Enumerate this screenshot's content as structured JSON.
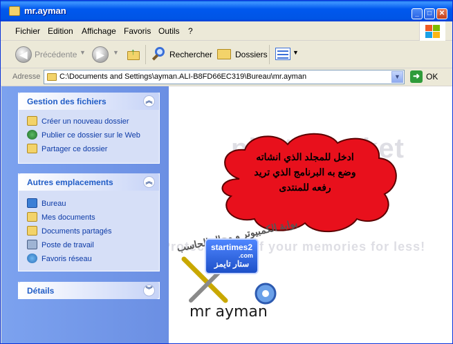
{
  "window": {
    "title": "mr.ayman"
  },
  "menubar": {
    "items": [
      "Fichier",
      "Edition",
      "Affichage",
      "Favoris",
      "Outils",
      "?"
    ]
  },
  "toolbar": {
    "back": "Précédente",
    "search": "Rechercher",
    "folders": "Dossiers"
  },
  "address": {
    "label": "Adresse",
    "path": "C:\\Documents and Settings\\ayman.ALI-B8FD66EC319\\Bureau\\mr.ayman",
    "go": "OK"
  },
  "sidebar": {
    "file_tasks": {
      "title": "Gestion des fichiers",
      "items": [
        "Créer un nouveau dossier",
        "Publier ce dossier sur le Web",
        "Partager ce dossier"
      ]
    },
    "other_places": {
      "title": "Autres emplacements",
      "items": [
        "Bureau",
        "Mes documents",
        "Documents partagés",
        "Poste de travail",
        "Favoris réseau"
      ]
    },
    "details": {
      "title": "Détails"
    }
  },
  "content": {
    "watermark_top": "photobucket",
    "watermark_bottom": "Protect more of your memories for less!",
    "cloud_lines": [
      "ادخل للمجلد الذي انشاته",
      "وضع به البرنامج الذي تريد",
      "رفعه للمنتدى"
    ],
    "logo_arabic": "بوابة الكمبيوتر و مجال الحاسب",
    "badge_top": "startimes2",
    "badge_com": ".com",
    "badge_arabic": "ستار تايمز",
    "caption": "mr ayman"
  }
}
